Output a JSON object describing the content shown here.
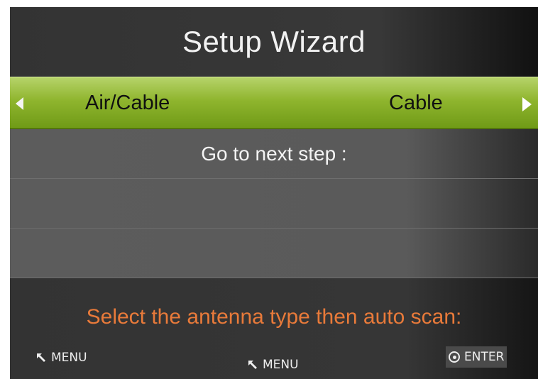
{
  "wizard": {
    "title": "Setup Wizard"
  },
  "menu": {
    "selected": {
      "label": "Air/Cable",
      "value": "Cable"
    },
    "next_step": "Go to next step :"
  },
  "footer": {
    "hint": "Select the antenna type then auto scan:",
    "keys": [
      {
        "icon": "back-arrow-icon",
        "label": "MENU"
      },
      {
        "icon": "back-arrow-icon",
        "label": "MENU"
      },
      {
        "icon": "enter-icon",
        "label": "ENTER"
      }
    ]
  },
  "colors": {
    "selected_row": "#8fb52e",
    "hint_text": "#e87a3a"
  }
}
